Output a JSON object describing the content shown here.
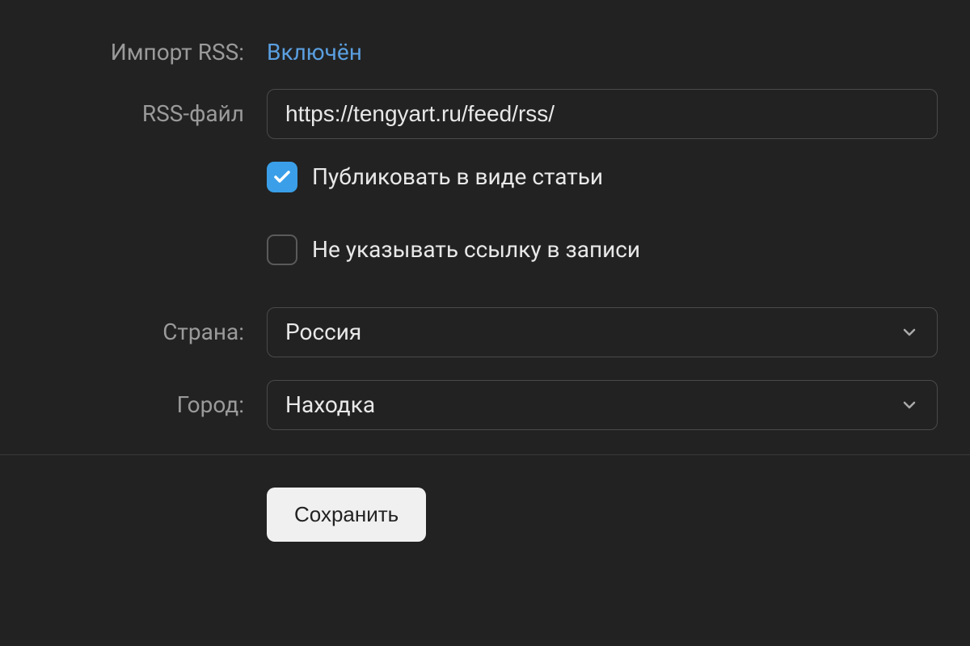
{
  "rss_import": {
    "label": "Импорт RSS:",
    "status": "Включён"
  },
  "rss_file": {
    "label": "RSS-файл",
    "value": "https://tengyart.ru/feed/rss/"
  },
  "options": {
    "publish_as_article": {
      "label": "Публиковать в виде статьи",
      "checked": true
    },
    "no_link_in_post": {
      "label": "Не указывать ссылку в записи",
      "checked": false
    }
  },
  "country": {
    "label": "Страна:",
    "value": "Россия"
  },
  "city": {
    "label": "Город:",
    "value": "Находка"
  },
  "actions": {
    "save": "Сохранить"
  }
}
